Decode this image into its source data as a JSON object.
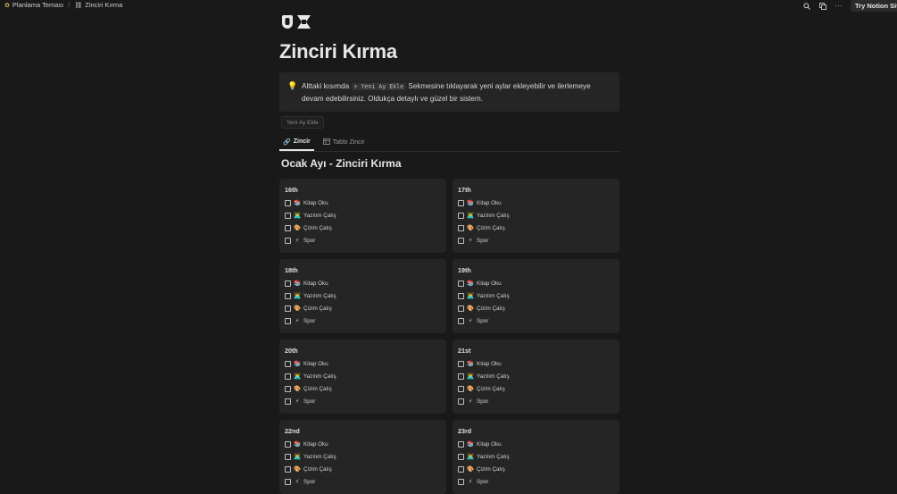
{
  "breadcrumb": {
    "parent": {
      "label": "Planlama Teması",
      "icon": "seedling-icon"
    },
    "current": {
      "label": "Zinciri Kırma",
      "icon": "chain-icon"
    }
  },
  "topbar": {
    "try_label": "Try Notion Sites"
  },
  "page": {
    "icon": "chain-link-icon",
    "title": "Zinciri Kırma",
    "callout": {
      "icon": "lightbulb-icon",
      "text_before": "Alttaki kısımda ",
      "code": "+ Yeni Ay Ekle",
      "text_after": " Sekmesine tıklayarak yeni aylar ekleyebilir ve ilerlemeye devam edebilirsiniz. Oldukça detaylı ve güzel bir sistem."
    },
    "new_month_button": "Yeni Ay Ekle",
    "tabs": [
      {
        "label": "Zincir",
        "icon": "link-icon",
        "active": true
      },
      {
        "label": "Tablo Zincir",
        "icon": "table-icon",
        "active": false
      }
    ],
    "section_title": "Ocak Ayı - Zinciri Kırma",
    "tasks": [
      {
        "label": "Kitap Oku",
        "emoji": "📚"
      },
      {
        "label": "Yazılım Çalış",
        "emoji": "👨‍💻"
      },
      {
        "label": "Çizim Çalış",
        "emoji": "🎨"
      },
      {
        "label": "Spor",
        "emoji": "⚡"
      }
    ],
    "cards": [
      {
        "day": "16th"
      },
      {
        "day": "17th"
      },
      {
        "day": "18th"
      },
      {
        "day": "19th"
      },
      {
        "day": "20th"
      },
      {
        "day": "21st"
      },
      {
        "day": "22nd"
      },
      {
        "day": "23rd"
      }
    ]
  }
}
